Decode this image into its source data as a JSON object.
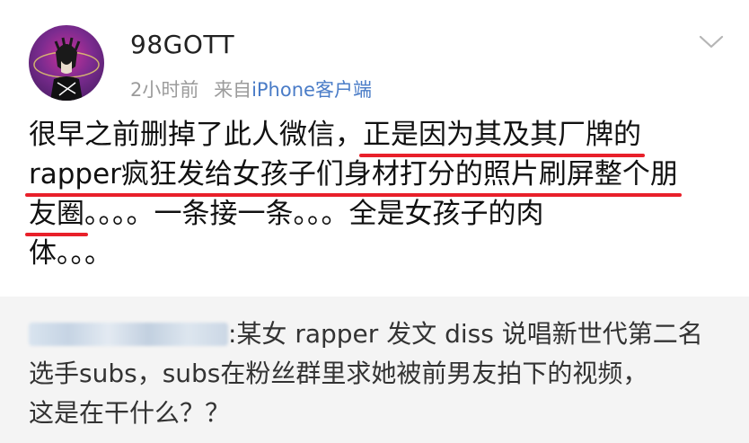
{
  "post": {
    "username": "98GOTT",
    "time": "2小时前",
    "source_prefix": "来自",
    "source": "iPhone客户端",
    "content_lines": [
      {
        "before": "很早之前删掉了此人微信，",
        "highlight": "正是因为其及其厂牌的",
        "after": ""
      },
      {
        "before": "",
        "highlight": "rapper疯狂发给女孩子们身材打分的照片刷屏整个朋",
        "after": ""
      },
      {
        "before": "",
        "highlight": "友圈",
        "after": "。。。。一条接一条。。。全是女孩子的肉"
      },
      {
        "before": "体。。。",
        "highlight": "",
        "after": ""
      }
    ]
  },
  "repost": {
    "author_redacted": true,
    "lines": [
      ":某女 rapper 发文 diss 说唱新世代第二名",
      "选手subs，subs在粉丝群里求她被前男友拍下的视频，",
      "这是在干什么？？"
    ]
  },
  "icons": {
    "menu": "chevron-down-icon"
  },
  "colors": {
    "highlight_underline": "#e8202a",
    "source_link": "#4a7cc7",
    "repost_background": "#f4f4f4"
  }
}
